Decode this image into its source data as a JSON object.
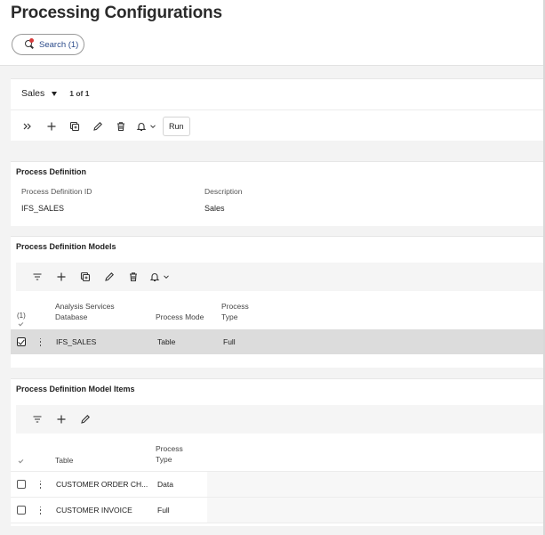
{
  "header": {
    "title": "Processing Configurations",
    "search_label": "Search (1)"
  },
  "selector": {
    "value": "Sales",
    "record_count": "1 of 1"
  },
  "toolbar": {
    "run_label": "Run"
  },
  "process_definition": {
    "title": "Process Definition",
    "fields": [
      {
        "label": "Process Definition ID",
        "value": "IFS_SALES"
      },
      {
        "label": "Description",
        "value": "Sales"
      }
    ]
  },
  "models": {
    "title": "Process Definition Models",
    "selected_count": "(1)",
    "columns": {
      "db_line1": "Analysis Services",
      "db_line2": "Database",
      "mode": "Process Mode",
      "type_line1": "Process",
      "type_line2": "Type"
    },
    "rows": [
      {
        "database": "IFS_SALES",
        "mode": "Table",
        "type": "Full",
        "selected": true
      }
    ]
  },
  "model_items": {
    "title": "Process Definition Model Items",
    "columns": {
      "table": "Table",
      "type_line1": "Process",
      "type_line2": "Type"
    },
    "rows": [
      {
        "table": "CUSTOMER ORDER CH...",
        "type": "Data"
      },
      {
        "table": "CUSTOMER INVOICE",
        "type": "Full"
      }
    ]
  }
}
